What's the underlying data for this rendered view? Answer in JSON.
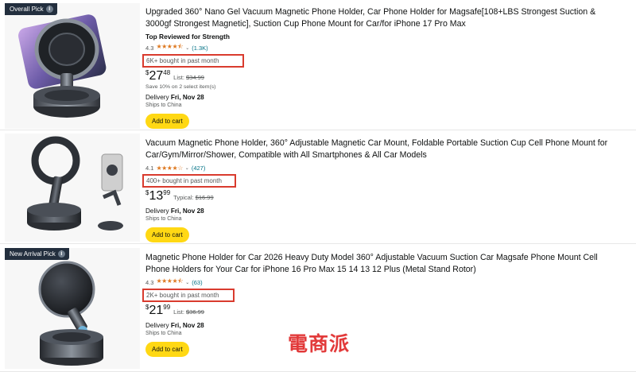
{
  "results": [
    {
      "badge": "Overall Pick",
      "title": "Upgraded 360° Nano Gel Vacuum Magnetic Phone Holder, Car Phone Holder for Magsafe[108+LBS Strongest Suction & 3000gf Strongest Magnetic], Suction Cup Phone Mount for Car/for iPhone 17 Pro Max",
      "tag": "Top Reviewed for Strength",
      "rating": "4.3",
      "stars": "★★★★⯪",
      "review_count": "(1.3K)",
      "bought": "6K+ bought in past month",
      "price_symbol": "$",
      "price_whole": "27",
      "price_fraction": "48",
      "list_label": "List: ",
      "list_price": "$34.99",
      "save_text": "Save 10% on 2 select item(s)",
      "delivery_label": "Delivery ",
      "delivery_date": "Fri, Nov 28",
      "ships": "Ships to China",
      "cart_label": "Add to cart"
    },
    {
      "title": "Vacuum Magnetic Phone Holder, 360° Adjustable Magnetic Car Mount, Foldable Portable Suction Cup Cell Phone Mount for Car/Gym/Mirror/Shower, Compatible with All Smartphones & All Car Models",
      "rating": "4.1",
      "stars": "★★★★☆",
      "review_count": "(427)",
      "bought": "400+ bought in past month",
      "price_symbol": "$",
      "price_whole": "13",
      "price_fraction": "99",
      "list_label": "Typical: ",
      "list_price": "$16.99",
      "delivery_label": "Delivery ",
      "delivery_date": "Fri, Nov 28",
      "ships": "Ships to China",
      "cart_label": "Add to cart"
    },
    {
      "badge": "New Arrival Pick",
      "title": "Magnetic Phone Holder for Car 2026 Heavy Duty Model 360° Adjustable Vacuum Suction Car Magsafe Phone Mount Cell Phone Holders for Your Car for iPhone 16 Pro Max 15 14 13 12 Plus (Metal Stand Rotor)",
      "rating": "4.3",
      "stars": "★★★★⯪",
      "review_count": "(63)",
      "bought": "2K+ bought in past month",
      "price_symbol": "$",
      "price_whole": "21",
      "price_fraction": "99",
      "list_label": "List: ",
      "list_price": "$36.99",
      "delivery_label": "Delivery ",
      "delivery_date": "Fri, Nov 28",
      "ships": "Ships to China",
      "cart_label": "Add to cart"
    }
  ],
  "icons": {
    "info": "i",
    "chevron": "⌄"
  },
  "watermark": "電商派",
  "colors": {
    "cart_button": "#ffd814",
    "highlight_box": "#d93b2e",
    "star": "#de7921",
    "link": "#007185",
    "badge_bg": "#232f3e"
  }
}
